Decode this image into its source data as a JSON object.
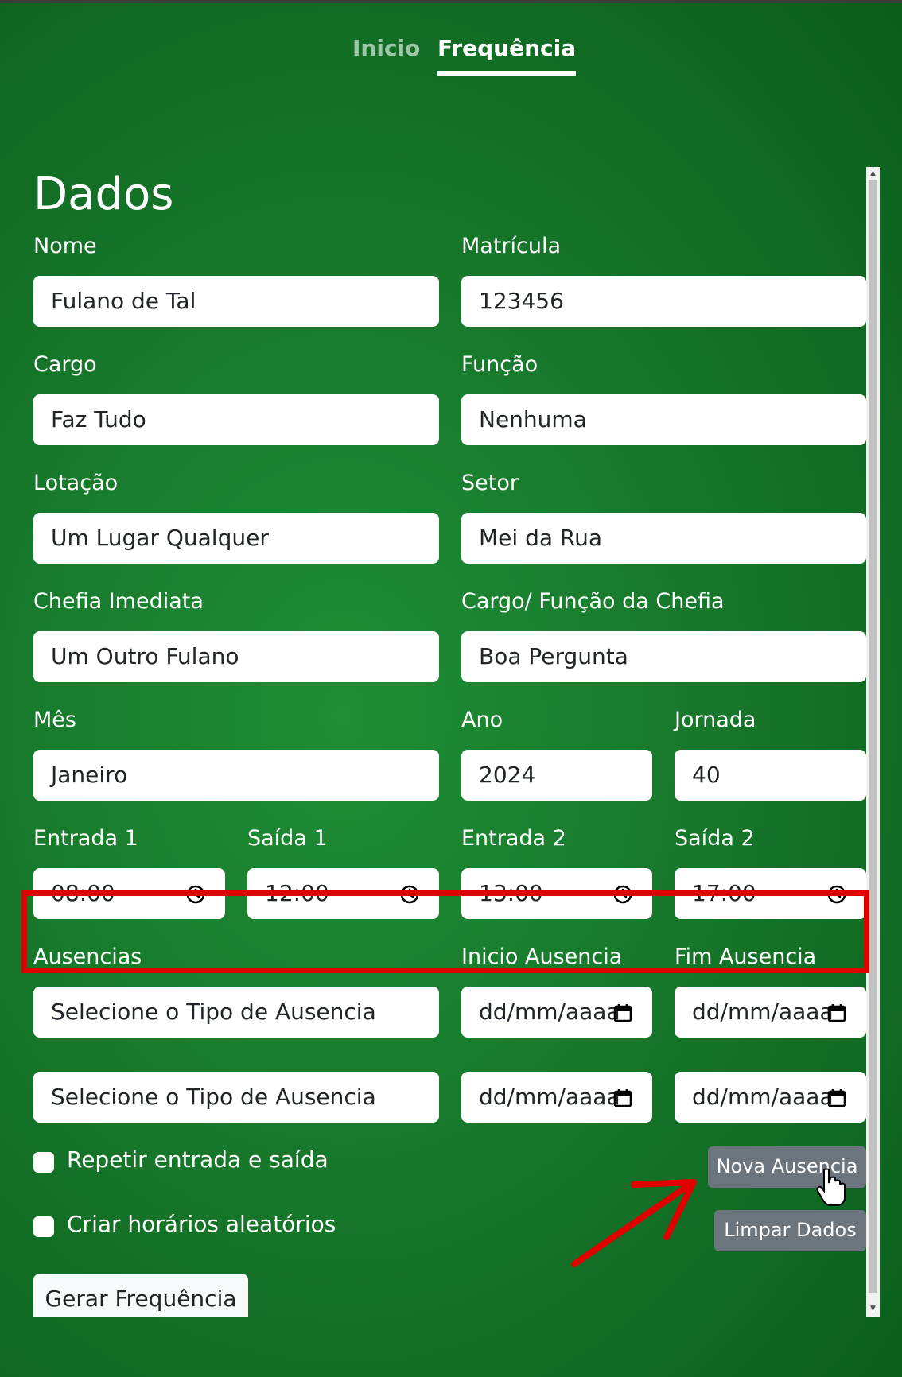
{
  "nav": {
    "tabs": [
      {
        "label": "Inicio",
        "active": false
      },
      {
        "label": "Frequência",
        "active": true
      }
    ]
  },
  "form": {
    "title": "Dados",
    "nome": {
      "label": "Nome",
      "value": "Fulano de Tal"
    },
    "matricula": {
      "label": "Matrícula",
      "value": "123456"
    },
    "cargo": {
      "label": "Cargo",
      "value": "Faz Tudo"
    },
    "funcao": {
      "label": "Função",
      "value": "Nenhuma"
    },
    "lotacao": {
      "label": "Lotação",
      "value": "Um Lugar Qualquer"
    },
    "setor": {
      "label": "Setor",
      "value": "Mei da Rua"
    },
    "chefia": {
      "label": "Chefia Imediata",
      "value": "Um Outro Fulano"
    },
    "cargo_chefia": {
      "label": "Cargo/ Função da Chefia",
      "value": "Boa Pergunta"
    },
    "mes": {
      "label": "Mês",
      "value": "Janeiro"
    },
    "ano": {
      "label": "Ano",
      "value": "2024"
    },
    "jornada": {
      "label": "Jornada",
      "value": "40"
    },
    "entrada1": {
      "label": "Entrada 1",
      "value": "08:00"
    },
    "saida1": {
      "label": "Saída 1",
      "value": "12:00"
    },
    "entrada2": {
      "label": "Entrada 2",
      "value": "13:00"
    },
    "saida2": {
      "label": "Saída 2",
      "value": "17:00"
    },
    "ausencias": {
      "label": "Ausencias",
      "inicio_label": "Inicio Ausencia",
      "fim_label": "Fim Ausencia",
      "rows": [
        {
          "tipo": "Selecione o Tipo de Ausencia",
          "inicio": "dd/mm/aaaa",
          "fim": "dd/mm/aaaa"
        },
        {
          "tipo": "Selecione o Tipo de Ausencia",
          "inicio": "dd/mm/aaaa",
          "fim": "dd/mm/aaaa"
        }
      ]
    },
    "repetir_label": "Repetir entrada e saída",
    "aleatorios_label": "Criar horários aleatórios",
    "nova_ausencia_label": "Nova Ausencia",
    "limpar_label": "Limpar Dados",
    "gerar_label": "Gerar Frequência"
  },
  "colors": {
    "background": "#1b8532",
    "annotation": "#e10000",
    "secondary_button": "#6c757d"
  },
  "icons": {
    "time": "clock-icon",
    "date": "calendar-icon",
    "cursor": "hand-pointer-icon"
  }
}
